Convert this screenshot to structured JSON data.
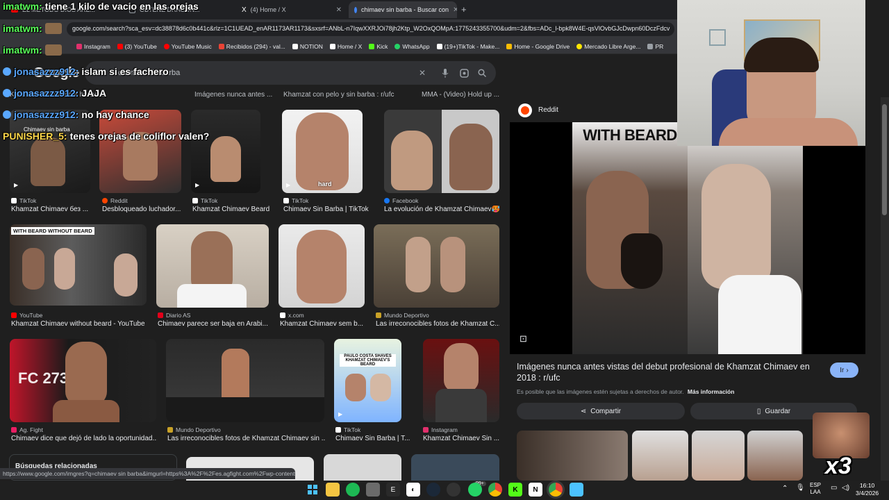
{
  "tabs": [
    {
      "label": "EL METODO DIOS ARE...",
      "icon": "youtube-icon"
    },
    {
      "label": "OBTENE DRAGON...",
      "icon": "generic-tab-icon"
    },
    {
      "label": "(4) Home / X",
      "icon": "x-icon"
    },
    {
      "label": "chimaev sin barba - Buscar con",
      "icon": "google-icon"
    }
  ],
  "address": {
    "url": "google.com/search?sca_esv=dc38878d6c0b441c&rlz=1C1UEAD_enAR1173AR1173&sxsrf=ANbL-n7IqwXXRJOi78jh2Ktp_W2OxQOMpA:1775243355700&udm=2&fbs=ADc_l-bpk8W4E-qsVlOvbGJcDwpn60DczFdcv"
  },
  "bookmarks": [
    {
      "label": "Instagram",
      "color": "#e1306c"
    },
    {
      "label": "(3) YouTube",
      "color": "#ff0000"
    },
    {
      "label": "YouTube Music",
      "color": "#ff0000"
    },
    {
      "label": "Recibidos (294) - val...",
      "color": "#ea4335"
    },
    {
      "label": "NOTION",
      "color": "#ffffff"
    },
    {
      "label": "Home / X",
      "color": "#ffffff"
    },
    {
      "label": "Kick",
      "color": "#53fc18"
    },
    {
      "label": "WhatsApp",
      "color": "#25d366"
    },
    {
      "label": "(19+)TikTok - Make...",
      "color": "#ffffff"
    },
    {
      "label": "Home - Google Drive",
      "color": "#fbbc04"
    },
    {
      "label": "Mercado Libre Arge...",
      "color": "#ffe600"
    },
    {
      "label": "PR",
      "color": "#9aa0a6"
    }
  ],
  "search": {
    "logo": "Google",
    "query": "chimaev sin barba"
  },
  "chips": [
    "Khamzat Chimaev cut his be...",
    "Imágenes nunca antes ...",
    "Khamzat con pelo y sin barba : r/ufc",
    "MMA - (Video) Hold up ..."
  ],
  "results": [
    {
      "source": "TikTok",
      "title": "Khamzat Chimaev без ...",
      "srcColor": "#ffffff",
      "thumbLabel": "Chimaev sin barba"
    },
    {
      "source": "Reddit",
      "title": "Desbloqueado luchador...",
      "srcColor": "#ff4500"
    },
    {
      "source": "TikTok",
      "title": "Khamzat Chimaev Beard Transfo...",
      "srcColor": "#ffffff"
    },
    {
      "source": "TikTok",
      "title": "Chimaev Sin Barba | TikTok",
      "srcColor": "#ffffff",
      "thumbLabel": "hard"
    },
    {
      "source": "Facebook",
      "title": "La evolución de Khamzat Chimaev🥵",
      "srcColor": "#1877f2"
    },
    {
      "source": "YouTube",
      "title": "Khamzat Chimaev without beard - YouTube",
      "srcColor": "#ff0000",
      "thumbLabel": "WITH BEARD   WITHOUT BEARD"
    },
    {
      "source": "Diario AS",
      "title": "Chimaev parece ser baja en Arabi...",
      "srcColor": "#e2001a"
    },
    {
      "source": "x.com",
      "title": "Khamzat Chimaev sem b...",
      "srcColor": "#ffffff"
    },
    {
      "source": "Mundo Deportivo",
      "title": "Las irreconocibles fotos de Khamzat C...",
      "srcColor": "#c9a227"
    },
    {
      "source": "Ag. Fight",
      "title": "Chimaev dice que dejó de lado la oportunidad...",
      "srcColor": "#e91e63",
      "thumbLabel": "FC 273"
    },
    {
      "source": "Mundo Deportivo",
      "title": "Las irreconocibles fotos de Khamzat Chimaev sin ...",
      "srcColor": "#c9a227"
    },
    {
      "source": "TikTok",
      "title": "Chimaev Sin Barba | T...",
      "srcColor": "#ffffff",
      "thumbLabel": "PAULO COSTA SHAVES KHAMZAT CHIMAEV'S BEARD"
    },
    {
      "source": "Instagram",
      "title": "Khamzat Chimaev Sin ...",
      "srcColor": "#e1306c"
    }
  ],
  "related": {
    "label": "Búsquedas relacionadas"
  },
  "panel": {
    "source": "Reddit",
    "imageLabel": "WITH BEARD",
    "title": "Imágenes nunca antes vistas del debut profesional de Khamzat Chimaev en 2018 : r/ufc",
    "goButton": "Ir",
    "note": "Es posible que las imágenes estén sujetas a derechos de autor.",
    "noteLink": "Más información",
    "share": "Compartir",
    "save": "Guardar"
  },
  "statusUrl": "https://www.google.com/imgres?q=chimaev sin barba&imgurl=https%3A%2F%2Fes.agfight.com%2Fwp-content%2F...",
  "chat": [
    {
      "user": "imatwm:",
      "msg": "tiene 1 kilo de vacio en las orejas",
      "color": "#59ff59"
    },
    {
      "user": "imatwm:",
      "msg": "",
      "color": "#59ff59"
    },
    {
      "user": "imatwm:",
      "msg": "",
      "color": "#59ff59"
    },
    {
      "user": "jonasazzz912:",
      "msg": "islam si es fachero",
      "color": "#5aa8ff"
    },
    {
      "user": "jonasazzz912:",
      "msg": "JAJA",
      "color": "#5aa8ff"
    },
    {
      "user": "jonasazzz912:",
      "msg": "no hay chance",
      "color": "#5aa8ff"
    },
    {
      "user": "PUNISHER_5:",
      "msg": "tenes orejas de coliflor valen?",
      "color": "#ffd84a"
    }
  ],
  "overlay": {
    "multiplier": "x3"
  },
  "taskbar": {
    "lang": "ESP",
    "lang2": "LAA",
    "time": "16:10",
    "date": "3/4/2026",
    "badge": "99+"
  }
}
